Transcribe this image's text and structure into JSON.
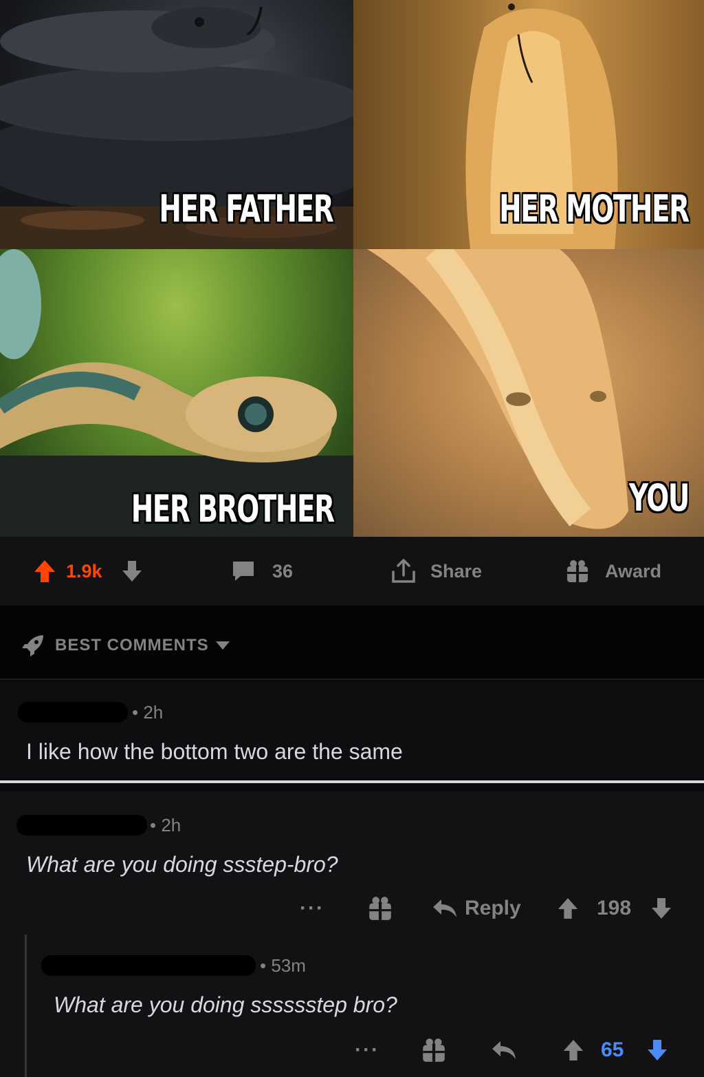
{
  "meme": {
    "top_left_caption": "HER FATHER",
    "top_right_caption": "HER MOTHER",
    "bottom_left_caption": "HER BROTHER",
    "bottom_right_caption": "YOU"
  },
  "post_actions": {
    "score": "1.9k",
    "comment_count": "36",
    "share_label": "Share",
    "award_label": "Award",
    "upvote_color": "#ff4500"
  },
  "sort": {
    "label": "BEST COMMENTS"
  },
  "comments": [
    {
      "time": "• 2h",
      "body": "I like how the bottom two are the same"
    },
    {
      "time": "• 2h",
      "body": "What are you doing ssstep-bro?",
      "more": "···",
      "reply_label": "Reply",
      "score": "198"
    },
    {
      "time": "• 53m",
      "body": "What are you doing sssssstep bro?",
      "more": "···",
      "score": "65",
      "vote_color": "#4a8bf5"
    }
  ]
}
